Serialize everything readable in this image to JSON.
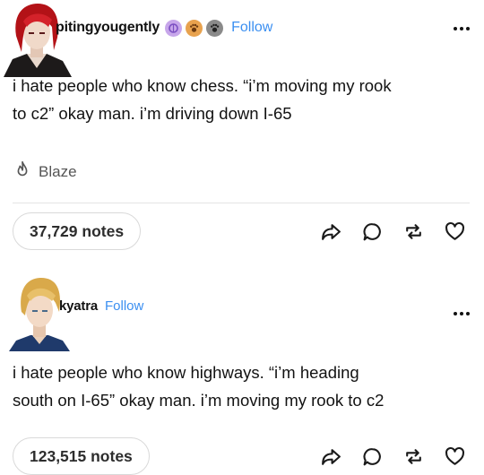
{
  "posts": [
    {
      "blogname": "pitingyougently",
      "follow_label": "Follow",
      "badges": [
        "brain-badge-icon",
        "paw-badge-icon",
        "paw-badge-icon"
      ],
      "body_lines": [
        "i hate people who know chess. “i’m moving my rook",
        "to c2” okay man. i’m driving down I-65"
      ],
      "tag_label": "Blaze",
      "notes": "37,729 notes",
      "colors": {
        "follow": "#3b8ff1",
        "badge1": "#c7a6ea",
        "badge2": "#e8a24e",
        "badge3": "#8a8a8a"
      }
    },
    {
      "blogname": "kyatra",
      "follow_label": "Follow",
      "body_lines": [
        "i hate people who know highways. “i’m heading",
        "south on I-65” okay man. i’m moving my rook to c2"
      ],
      "notes": "123,515 notes"
    }
  ],
  "actions": [
    "share-icon",
    "reply-icon",
    "reblog-icon",
    "like-icon"
  ]
}
